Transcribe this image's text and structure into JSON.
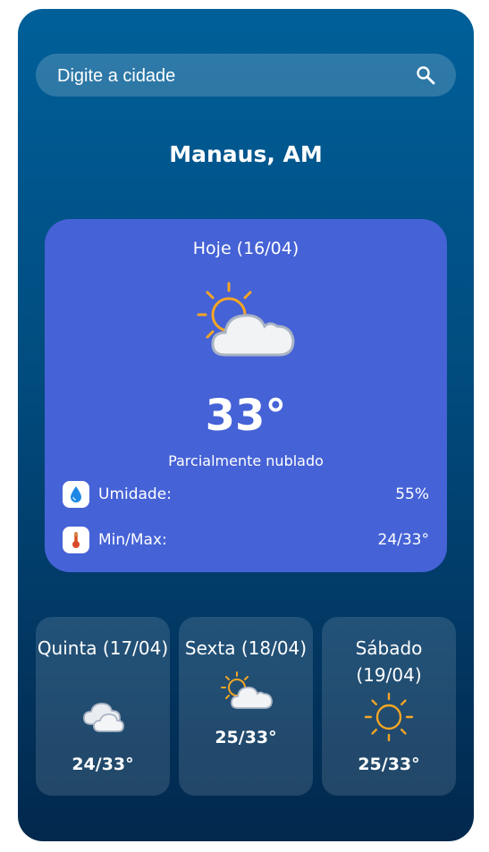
{
  "search": {
    "placeholder": "Digite a cidade",
    "icon": "search-icon"
  },
  "location": {
    "city": "Manaus, AM"
  },
  "today": {
    "date_label": "Hoje (16/04)",
    "icon": "partly-cloudy-icon",
    "temperature": "33°",
    "condition": "Parcialmente nublado",
    "details": [
      {
        "icon": "humidity-drop-icon",
        "label": "Umidade:",
        "value": "55%"
      },
      {
        "icon": "thermometer-icon",
        "label": "Min/Max:",
        "value": "24/33°"
      }
    ]
  },
  "forecast": [
    {
      "name": "Quinta (17/04)",
      "icon": "cloudy-icon",
      "range": "24/33°"
    },
    {
      "name": "Sexta (18/04)",
      "icon": "partly-cloudy-icon",
      "range": "25/33°"
    },
    {
      "name": "Sábado (19/04)",
      "icon": "sunny-icon",
      "range": "25/33°"
    }
  ],
  "colors": {
    "background_top": "#005f99",
    "background_bottom": "#02284d",
    "today_card": "#4562d6",
    "sun": "#f5a623",
    "cloud": "#f2f3f5"
  }
}
